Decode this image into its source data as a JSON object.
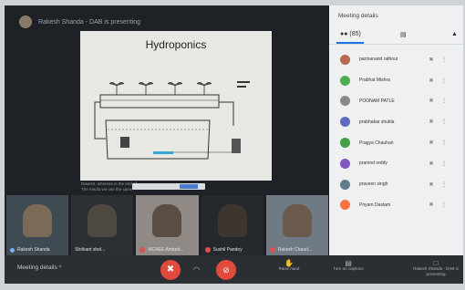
{
  "presenter_bar": {
    "text": "Rakesh Shanda - DAB is presenting"
  },
  "slide": {
    "title": "Hydroponics"
  },
  "caption": {
    "line1": "Rakesh, whereas in the end of...",
    "line2": "The media we use the same"
  },
  "thumbnails": [
    {
      "name": "Rakesh Shanda",
      "muted": false,
      "pinned": true
    },
    {
      "name": "Shrikant shel...",
      "muted": false,
      "pinned": false
    },
    {
      "name": "MCAEE Ambed...",
      "muted": true,
      "pinned": false
    },
    {
      "name": "Sushil Pandey",
      "muted": true,
      "pinned": false
    },
    {
      "name": "Rakesh Chaud...",
      "muted": true,
      "pinned": false
    }
  ],
  "bottom": {
    "meeting_details": "Meeting details",
    "chevron": "^",
    "raise_hand": "Raise hand",
    "captions": "Turn on captions",
    "presenting": "Rakesh Shanda - DAB is presenting"
  },
  "panel": {
    "title": "Meeting details",
    "tab_people_count": "(85)",
    "participants": [
      {
        "name": "parmanand rathour",
        "color": "#b86b4f"
      },
      {
        "name": "Prabhat Mishra",
        "color": "#4caf50"
      },
      {
        "name": "POONAM PATLE",
        "color": "#8a8a8a"
      },
      {
        "name": "prabhakar shukla",
        "color": "#5c6bc0"
      },
      {
        "name": "Pragya Chauhan",
        "color": "#43a047"
      },
      {
        "name": "pramod reddy",
        "color": "#7e57c2"
      },
      {
        "name": "praveen singh",
        "color": "#607d8b"
      },
      {
        "name": "Priyam Dastam",
        "color": "#ff7043"
      }
    ]
  },
  "colors": {
    "danger": "#e04b3e",
    "accent": "#1a73e8"
  }
}
